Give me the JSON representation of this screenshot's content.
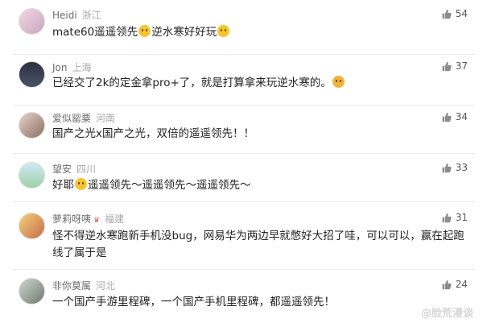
{
  "comments": [
    {
      "name": "Heidi",
      "location": "浙江",
      "text_before": "mate60遥遥领先",
      "text_mid": "逆水寒好好玩",
      "text_after": "",
      "likes": "54"
    },
    {
      "name": "Jon",
      "location": "上海",
      "text_before": "已经交了2k的定金拿pro+了，就是打算拿来玩逆水寒的。",
      "text_mid": "",
      "text_after": "",
      "likes": "37"
    },
    {
      "name": "爱似罂粟",
      "location": "河南",
      "text_before": "国产之光x国产之光，双倍的遥遥领先！！",
      "text_mid": "",
      "text_after": "",
      "likes": "34"
    },
    {
      "name": "望安",
      "location": "四川",
      "text_before": "好耶",
      "text_mid": "遥遥领先～遥遥领先～遥遥领先～",
      "text_after": "",
      "likes": "33"
    },
    {
      "name": "萝莉呀咦",
      "location": "福建",
      "text_before": "怪不得逆水寒跑新手机没bug，网易华为两边早就憋好大招了哇，可以可以，赢在起跑线了属于是",
      "text_mid": "",
      "text_after": "",
      "likes": "31"
    },
    {
      "name": "非你莫属",
      "location": "河北",
      "text_before": "一个国产手游里程碑，一个国产手机里程碑，都遥遥领先！",
      "text_mid": "",
      "text_after": "",
      "likes": "24"
    }
  ],
  "watermark": "@脸荒漫谈",
  "colors": {
    "name": "#6b6b6b",
    "location": "#a8a8a8",
    "text": "#222222",
    "divider": "#e9e9e9"
  }
}
